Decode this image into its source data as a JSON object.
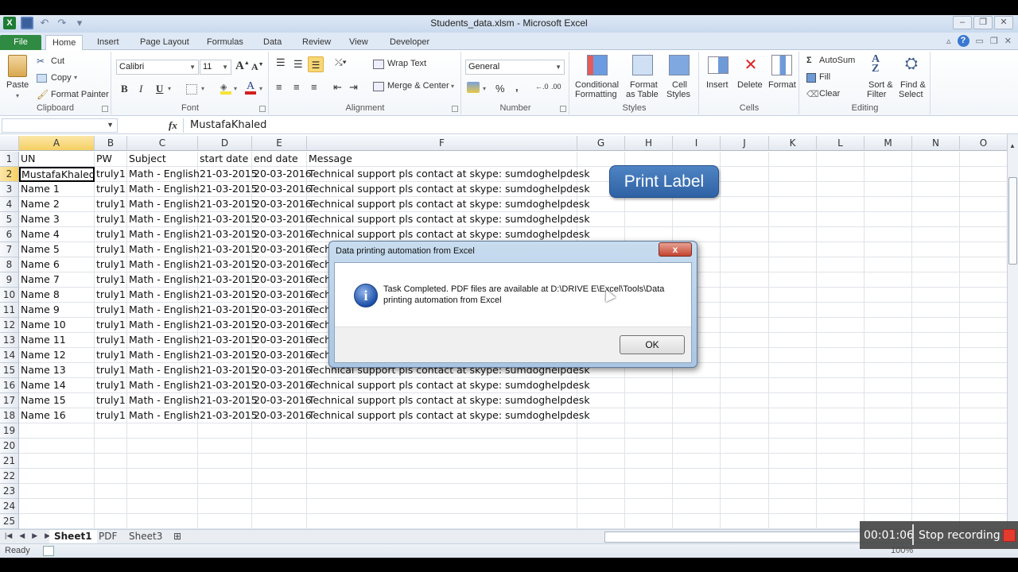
{
  "window": {
    "title": "Students_data.xlsm - Microsoft Excel",
    "controls": [
      "minimize",
      "restore",
      "close"
    ]
  },
  "quick_access": [
    "excel-logo",
    "save",
    "undo",
    "redo",
    "customize"
  ],
  "ribbon_tabs": [
    "File",
    "Home",
    "Insert",
    "Page Layout",
    "Formulas",
    "Data",
    "Review",
    "View",
    "Developer"
  ],
  "active_tab": "Home",
  "ribbon": {
    "clipboard": {
      "label": "Clipboard",
      "paste": "Paste",
      "cut": "Cut",
      "copy": "Copy",
      "format_painter": "Format Painter"
    },
    "font": {
      "label": "Font",
      "font_name": "Calibri",
      "font_size": "11",
      "bold": "B",
      "italic": "I",
      "underline": "U"
    },
    "alignment": {
      "label": "Alignment",
      "wrap_text": "Wrap Text",
      "merge_center": "Merge & Center"
    },
    "number": {
      "label": "Number",
      "format": "General",
      "percent": "%",
      "comma": ",",
      "inc_decimal": ".0→.00",
      "dec_decimal": ".00→.0"
    },
    "styles": {
      "label": "Styles",
      "conditional": "Conditional",
      "conditional2": "Formatting",
      "format_table": "Format",
      "format_table2": "as Table",
      "cell_styles": "Cell",
      "cell_styles2": "Styles"
    },
    "cells": {
      "label": "Cells",
      "insert": "Insert",
      "delete": "Delete",
      "format": "Format"
    },
    "editing": {
      "label": "Editing",
      "autosum": "AutoSum",
      "fill": "Fill",
      "clear": "Clear",
      "sort_filter": "Sort &",
      "sort_filter2": "Filter",
      "find_select": "Find &",
      "find_select2": "Select"
    }
  },
  "formula_bar": {
    "name_box": "",
    "fx": "fx",
    "content": "MustafaKhaled"
  },
  "sheet": {
    "columns": [
      "A",
      "B",
      "C",
      "D",
      "E",
      "F",
      "G",
      "H",
      "I",
      "J",
      "K",
      "L",
      "M",
      "N",
      "O"
    ],
    "selected_column": "A",
    "selected_row": 2,
    "row_numbers": [
      "1",
      "2",
      "3",
      "4",
      "5",
      "6",
      "7",
      "8",
      "9",
      "10",
      "11",
      "12",
      "13",
      "14",
      "15",
      "16",
      "17",
      "18",
      "19",
      "20",
      "21",
      "22",
      "23",
      "24",
      "25"
    ],
    "header_row": [
      "UN",
      "PW",
      "Subject",
      "start date",
      "end date",
      "Message"
    ],
    "rows": [
      [
        "MustafaKhaled",
        "truly1",
        "Math - English",
        "21-03-2015",
        "20-03-2016",
        "Technical support pls contact at skype: sumdoghelpdesk"
      ],
      [
        "Name 1",
        "truly1",
        "Math - English",
        "21-03-2015",
        "20-03-2016",
        "Technical support pls contact at skype: sumdoghelpdesk"
      ],
      [
        "Name 2",
        "truly1",
        "Math - English",
        "21-03-2015",
        "20-03-2016",
        "Technical support pls contact at skype: sumdoghelpdesk"
      ],
      [
        "Name 3",
        "truly1",
        "Math - English",
        "21-03-2015",
        "20-03-2016",
        "Technical support pls contact at skype: sumdoghelpdesk"
      ],
      [
        "Name 4",
        "truly1",
        "Math - English",
        "21-03-2015",
        "20-03-2016",
        "Technical support pls contact at skype: sumdoghelpdesk"
      ],
      [
        "Name 5",
        "truly1",
        "Math - English",
        "21-03-2015",
        "20-03-2016",
        "Technical support pls contact at skype: sumdoghelpdesk"
      ],
      [
        "Name 6",
        "truly1",
        "Math - English",
        "21-03-2015",
        "20-03-2016",
        "Technical support pls contact at skype: sumdoghelpdesk"
      ],
      [
        "Name 7",
        "truly1",
        "Math - English",
        "21-03-2015",
        "20-03-2016",
        "Technical support pls contact at skype: sumdoghelpdesk"
      ],
      [
        "Name 8",
        "truly1",
        "Math - English",
        "21-03-2015",
        "20-03-2016",
        "Technical support pls contact at skype: sumdoghelpdesk"
      ],
      [
        "Name 9",
        "truly1",
        "Math - English",
        "21-03-2015",
        "20-03-2016",
        "Technical support pls contact at skype: sumdoghelpdesk"
      ],
      [
        "Name 10",
        "truly1",
        "Math - English",
        "21-03-2015",
        "20-03-2016",
        "Technical support pls contact at skype: sumdoghelpdesk"
      ],
      [
        "Name 11",
        "truly1",
        "Math - English",
        "21-03-2015",
        "20-03-2016",
        "Technical support pls contact at skype: sumdoghelpdesk"
      ],
      [
        "Name 12",
        "truly1",
        "Math - English",
        "21-03-2015",
        "20-03-2016",
        "Technical support pls contact at skype: sumdoghelpdesk"
      ],
      [
        "Name 13",
        "truly1",
        "Math - English",
        "21-03-2015",
        "20-03-2016",
        "Technical support pls contact at skype: sumdoghelpdesk"
      ],
      [
        "Name 14",
        "truly1",
        "Math - English",
        "21-03-2015",
        "20-03-2016",
        "Technical support pls contact at skype: sumdoghelpdesk"
      ],
      [
        "Name 15",
        "truly1",
        "Math - English",
        "21-03-2015",
        "20-03-2016",
        "Technical support pls contact at skype: sumdoghelpdesk"
      ],
      [
        "Name 16",
        "truly1",
        "Math - English",
        "21-03-2015",
        "20-03-2016",
        "Technical support pls contact at skype: sumdoghelpdesk"
      ]
    ]
  },
  "print_button": {
    "label": "Print Label",
    "color": "#3a6fb3"
  },
  "dialog": {
    "title": "Data printing automation from Excel",
    "message": "Task Completed. PDF files are available at D:\\DRIVE E\\Excel\\Tools\\Data printing automation from Excel",
    "ok_label": "OK",
    "close_label": "x"
  },
  "sheet_tabs": [
    "Sheet1",
    "PDF",
    "Sheet3"
  ],
  "active_sheet": "Sheet1",
  "status": {
    "ready": "Ready",
    "zoom": "100%"
  },
  "recording": {
    "time": "00:01:06",
    "stop_label": "Stop recording",
    "stop_color": "#e53b2e"
  }
}
